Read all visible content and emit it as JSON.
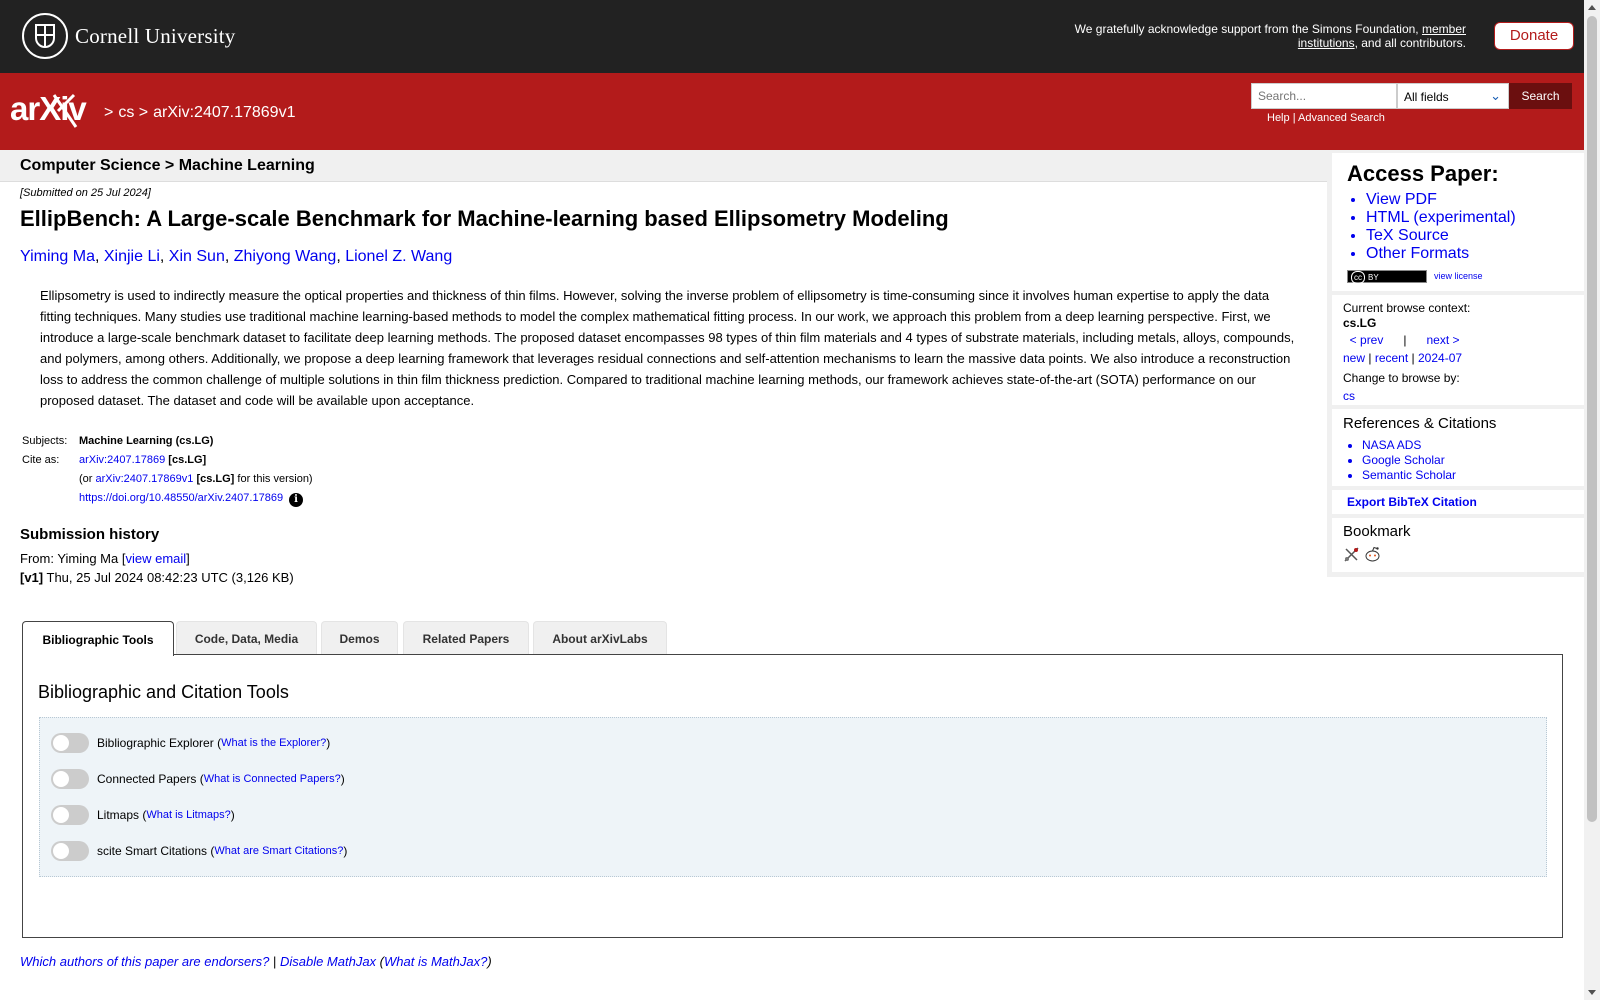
{
  "header": {
    "university": "Cornell University",
    "support_text": "We gratefully acknowledge support from the Simons Foundation,",
    "support_link": "member institutions",
    "support_tail": ", and all contributors.",
    "donate_label": "Donate"
  },
  "nav": {
    "logo_text": "arXiv",
    "crumb_sep": ">",
    "crumb_cs": "cs",
    "crumb_id": "arXiv:2407.17869v1",
    "search_placeholder": "Search...",
    "field_select": "All fields",
    "search_button": "Search",
    "help_link": "Help",
    "links_sep": "|",
    "advanced_link": "Advanced Search"
  },
  "subheader": "Computer Science > Machine Learning",
  "paper": {
    "submitted": "[Submitted on 25 Jul 2024]",
    "title": "EllipBench: A Large-scale Benchmark for Machine-learning based Ellipsometry Modeling",
    "authors": [
      "Yiming Ma",
      "Xinjie Li",
      "Xin Sun",
      "Zhiyong Wang",
      "Lionel Z. Wang"
    ],
    "abstract": "Ellipsometry is used to indirectly measure the optical properties and thickness of thin films. However, solving the inverse problem of ellipsometry is time-consuming since it involves human expertise to apply the data fitting techniques. Many studies use traditional machine learning-based methods to model the complex mathematical fitting process. In our work, we approach this problem from a deep learning perspective. First, we introduce a large-scale benchmark dataset to facilitate deep learning methods. The proposed dataset encompasses 98 types of thin film materials and 4 types of substrate materials, including metals, alloys, compounds, and polymers, among others. Additionally, we propose a deep learning framework that leverages residual connections and self-attention mechanisms to learn the massive data points. We also introduce a reconstruction loss to address the common challenge of multiple solutions in thin film thickness prediction. Compared to traditional machine learning methods, our framework achieves state-of-the-art (SOTA) performance on our proposed dataset. The dataset and code will be available upon acceptance."
  },
  "meta": {
    "subjects_label": "Subjects:",
    "subjects_value": "Machine Learning (cs.LG)",
    "cite_label": "Cite as:",
    "cite_id": "arXiv:2407.17869",
    "cite_cat": "[cs.LG]",
    "cite_or": "(or",
    "cite_version_id": "arXiv:2407.17869v1",
    "cite_version_tail": "for this version)",
    "doi": "https://doi.org/10.48550/arXiv.2407.17869"
  },
  "history": {
    "title": "Submission history",
    "from_prefix": "From: Yiming Ma [",
    "view_email": "view email",
    "from_suffix": "]",
    "v1_label": "[v1]",
    "v1_text": "Thu, 25 Jul 2024 08:42:23 UTC (3,126 KB)"
  },
  "access": {
    "title": "Access Paper:",
    "links": [
      "View PDF",
      "HTML (experimental)",
      "TeX Source",
      "Other Formats"
    ],
    "license_badge": "BY",
    "license_cc": "cc",
    "view_license": "view license"
  },
  "browse": {
    "context_label": "Current browse context:",
    "context": "cs.LG",
    "prev": "< prev",
    "sep": "|",
    "next": "next >",
    "new": "new",
    "recent": "recent",
    "month": "2024-07",
    "change_label": "Change to browse by:",
    "cs": "cs"
  },
  "refs": {
    "title": "References & Citations",
    "links": [
      "NASA ADS",
      "Google Scholar",
      "Semantic Scholar"
    ]
  },
  "export_label": "Export BibTeX Citation",
  "bookmark_title": "Bookmark",
  "tabs": [
    "Bibliographic Tools",
    "Code, Data, Media",
    "Demos",
    "Related Papers",
    "About arXivLabs"
  ],
  "panel": {
    "title": "Bibliographic and Citation Tools",
    "tools": [
      {
        "label": "Bibliographic Explorer",
        "link": "What is the Explorer?"
      },
      {
        "label": "Connected Papers",
        "link": "What is Connected Papers?"
      },
      {
        "label": "Litmaps",
        "link": "What is Litmaps?"
      },
      {
        "label": "scite Smart Citations",
        "link": "What are Smart Citations?"
      }
    ]
  },
  "footer": {
    "endorsers": "Which authors of this paper are endorsers?",
    "sep": "|",
    "disable_mathjax": "Disable MathJax",
    "what_mathjax": "What is MathJax?"
  },
  "colors": {
    "arxiv_red": "#b31b1b",
    "topbar": "#222222",
    "link": "#0000ee"
  }
}
